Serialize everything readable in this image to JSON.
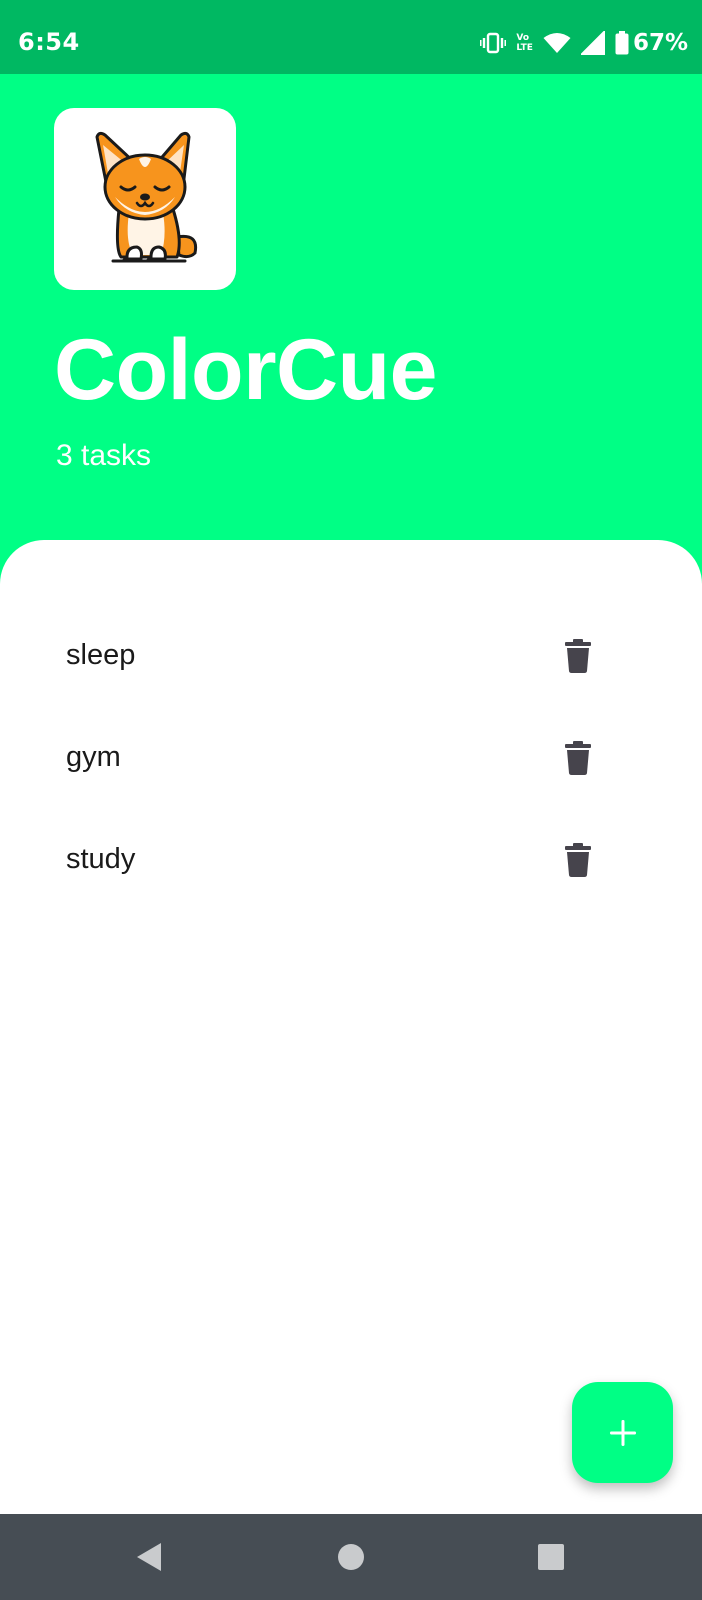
{
  "status_bar": {
    "time": "6:54",
    "volte_top": "Vo",
    "volte_bottom": "LTE",
    "battery_percent": "67%",
    "icons": [
      "vibrate-icon",
      "volte-icon",
      "wifi-icon",
      "cell-signal-icon",
      "battery-icon"
    ]
  },
  "header": {
    "title": "ColorCue",
    "task_count": "3 tasks",
    "background_color": "#00FF85",
    "avatar": "corgi-mascot"
  },
  "tasks": [
    {
      "label": "sleep"
    },
    {
      "label": "gym"
    },
    {
      "label": "study"
    }
  ],
  "fab": {
    "icon": "plus-icon",
    "color": "#00FF85"
  },
  "nav_bar": {
    "buttons": [
      "back-icon",
      "home-icon",
      "recents-icon"
    ]
  },
  "colors": {
    "accent": "#00FF85",
    "status_bar": "#00B862",
    "nav_bar": "#464D54",
    "delete_icon": "#46444C"
  }
}
